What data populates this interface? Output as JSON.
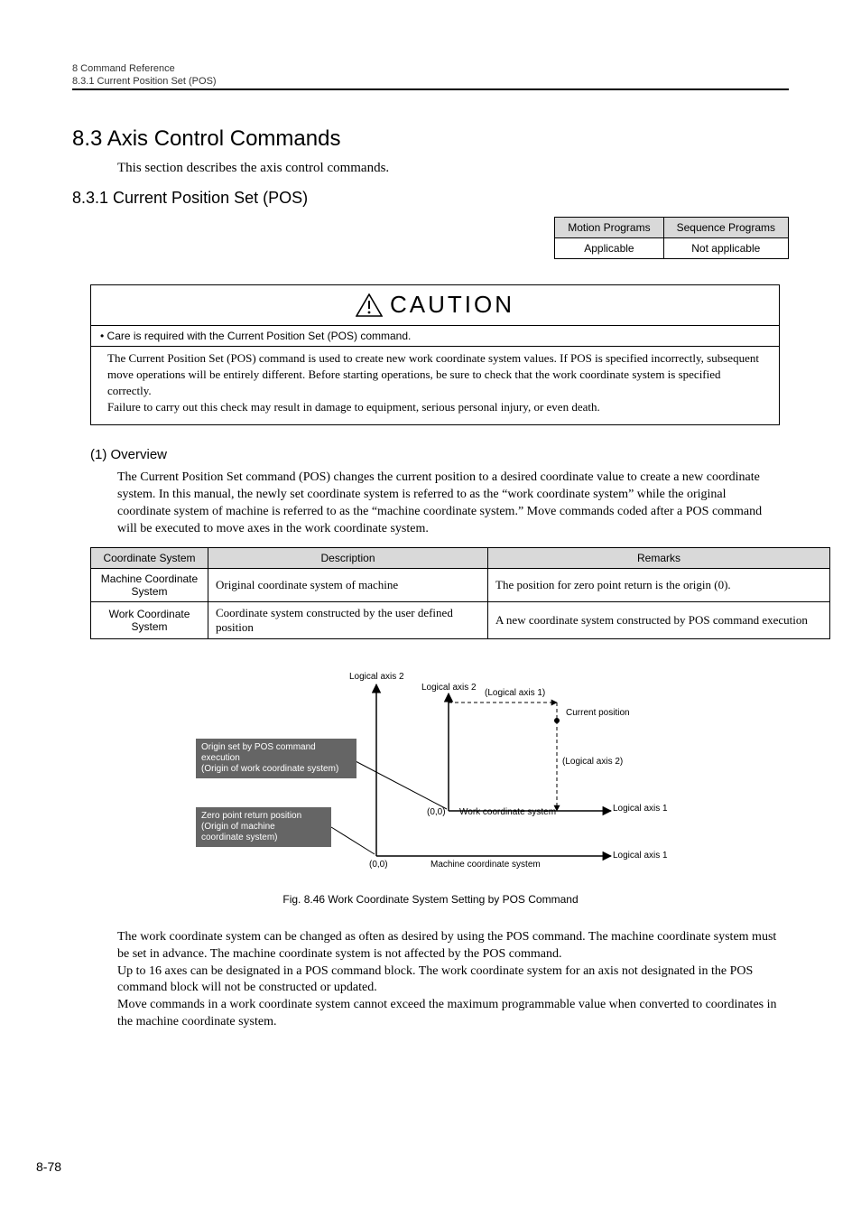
{
  "header": {
    "chapter": "8  Command Reference",
    "sub": "8.3.1  Current Position Set (POS)"
  },
  "section": {
    "title": "8.3  Axis Control Commands",
    "intro": "This section describes the axis control commands."
  },
  "subsection": {
    "title": "8.3.1  Current Position Set (POS)"
  },
  "applicability": {
    "headers": [
      "Motion Programs",
      "Sequence Programs"
    ],
    "row": [
      "Applicable",
      "Not applicable"
    ]
  },
  "caution": {
    "label": "CAUTION",
    "bullet": "• Care is required with the Current Position Set (POS) command.",
    "body1": "The Current Position Set (POS) command is used to create new work coordinate system values. If POS is specified incorrectly, subsequent move operations will be entirely different. Before starting operations, be sure to check that the work coordinate system is specified correctly.",
    "body2": "Failure to carry out this check may result in damage to equipment, serious personal injury, or even death."
  },
  "overview": {
    "heading": "(1) Overview",
    "text": "The Current Position Set command (POS) changes the current position to a desired coordinate value to create a new coordinate system. In this manual, the newly set coordinate system is referred to as the “work coordinate system” while the original coordinate system of machine is referred to as the “machine coordinate system.” Move commands coded after a POS command will be executed to move axes in the work coordinate system."
  },
  "coord_table": {
    "headers": [
      "Coordinate System",
      "Description",
      "Remarks"
    ],
    "rows": [
      {
        "label": "Machine Coordinate System",
        "desc": "Original coordinate system of machine",
        "remarks": "The position for zero point return is the origin (0)."
      },
      {
        "label": "Work Coordinate System",
        "desc": "Coordinate system constructed by the user defined position",
        "remarks": "A new coordinate system constructed by POS command execution"
      }
    ]
  },
  "diagram": {
    "labels": {
      "l_axis2_a": "Logical axis 2",
      "l_axis2_b": "Logical axis 2",
      "l_axis1_paren": "(Logical axis 1)",
      "current_pos": "Current position",
      "l_axis2_paren": "(Logical axis 2)",
      "l_axis1_a": "Logical axis 1",
      "l_axis1_b": "Logical axis 1",
      "origin00_a": "(0,0)",
      "origin00_b": "(0,0)",
      "work_cs": "Work coordinate system",
      "machine_cs": "Machine coordinate system"
    },
    "box1": "Origin set by POS command execution\n(Origin of work coordinate system)",
    "box2": "Zero point return position\n(Origin of machine\n coordinate system)",
    "caption": "Fig. 8.46  Work Coordinate System Setting by POS Command"
  },
  "body_paras": {
    "p1": "The work coordinate system can be changed as often as desired by using the POS command. The machine coordinate system must be set in advance. The machine coordinate system is not affected by the POS command.",
    "p2": "Up to 16 axes can be designated in a POS command block. The work coordinate system for an axis not designated in the POS command block will not be constructed or updated.",
    "p3": "Move commands in a work coordinate system cannot exceed the maximum programmable value when converted to coordinates in the machine coordinate system."
  },
  "page_num": "8-78"
}
